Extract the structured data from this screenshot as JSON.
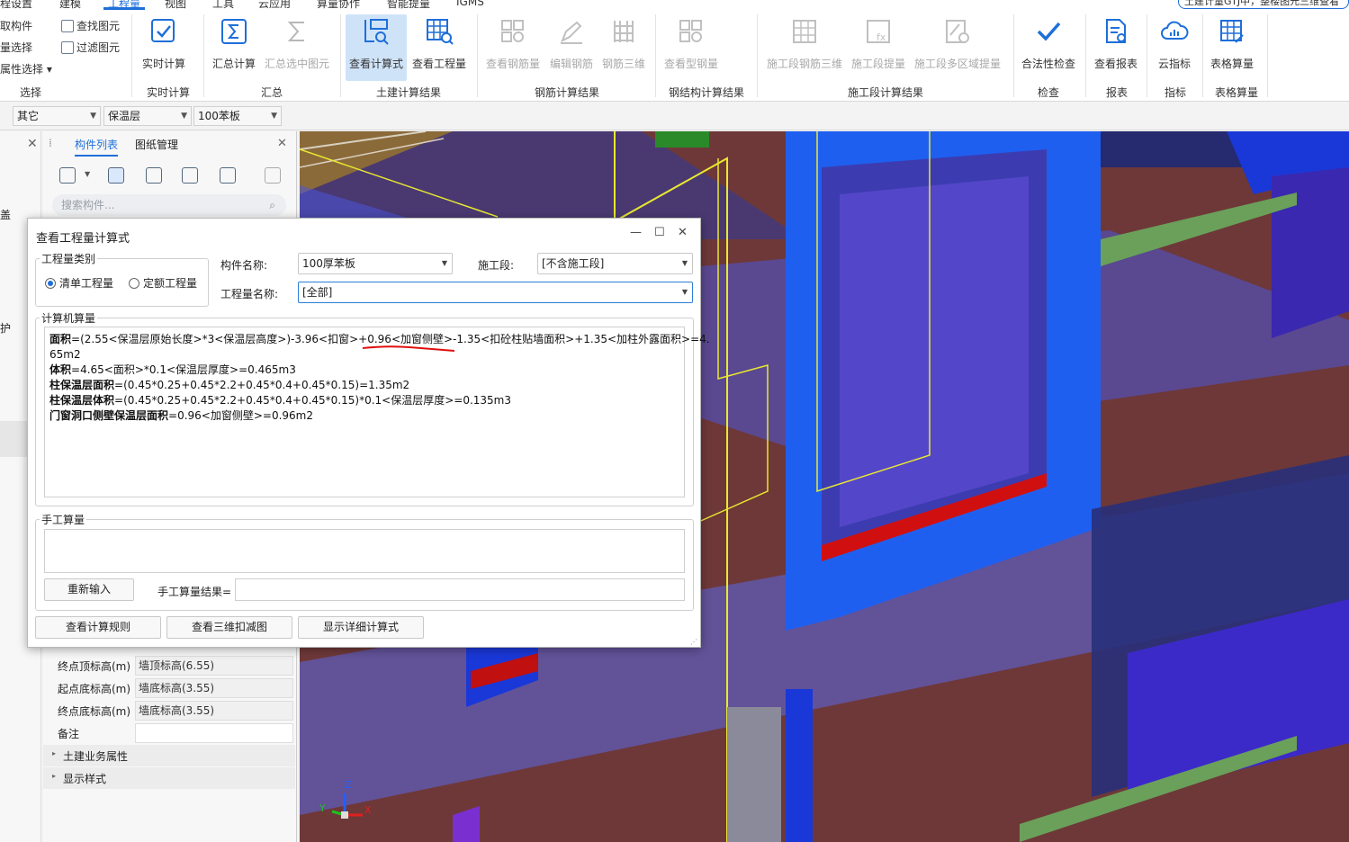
{
  "menu": {
    "items": [
      "程设置",
      "建模",
      "工程量",
      "视图",
      "工具",
      "云应用",
      "算量协作",
      "智能提量",
      "IGMS"
    ],
    "active_index": 2
  },
  "notice": "土建计量GTJ中，整楼图元三维查看",
  "ribbon": {
    "select_group": {
      "label": "选择",
      "cmds": [
        "取构件",
        "量选择",
        "属性选择"
      ],
      "cmds2": [
        "查找图元",
        "过滤图元"
      ]
    },
    "realtime_group": {
      "label": "实时计算",
      "btn": "实时计算"
    },
    "summary_group": {
      "label": "汇总",
      "btns": [
        "汇总计算",
        "汇总选中图元"
      ]
    },
    "civil_group": {
      "label": "土建计算结果",
      "btns": [
        "查看计算式",
        "查看工程量"
      ]
    },
    "rebar_group": {
      "label": "钢筋计算结果",
      "btns": [
        "查看钢筋量",
        "编辑钢筋",
        "钢筋三维"
      ]
    },
    "steel_group": {
      "label": "钢结构计算结果",
      "btns": [
        "查看型钢量"
      ]
    },
    "stage_group": {
      "label": "施工段计算结果",
      "btns": [
        "施工段钢筋三维",
        "施工段提量",
        "施工段多区域提量"
      ]
    },
    "check_group": {
      "label": "检查",
      "btn": "合法性检查"
    },
    "report_group": {
      "label": "报表",
      "btn": "查看报表"
    },
    "index_group": {
      "label": "指标",
      "btn": "云指标"
    },
    "table_group": {
      "label": "表格算量",
      "btn": "表格算量"
    }
  },
  "propbar": {
    "combo1": "其它",
    "combo2": "保温层",
    "combo3": "100苯板"
  },
  "leftstrip": {
    "labels": [
      "盖",
      "护"
    ]
  },
  "leftpanel": {
    "tabs": [
      "构件列表",
      "图纸管理"
    ],
    "search_placeholder": "搜索构件...",
    "props": [
      {
        "key": "终点顶标高(m)",
        "value": "墙顶标高(6.55)"
      },
      {
        "key": "起点底标高(m)",
        "value": "墙底标高(3.55)"
      },
      {
        "key": "终点底标高(m)",
        "value": "墙底标高(3.55)"
      },
      {
        "key": "备注",
        "value": ""
      }
    ],
    "sections": [
      "土建业务属性",
      "显示样式"
    ]
  },
  "dialog": {
    "title": "查看工程量计算式",
    "qty_type_label": "工程量类别",
    "radio_list": "清单工程量",
    "radio_quota": "定额工程量",
    "component_name_label": "构件名称:",
    "component_name_value": "100厚苯板",
    "stage_label": "施工段:",
    "stage_value": "[不含施工段]",
    "qty_name_label": "工程量名称:",
    "qty_name_value": "[全部]",
    "computer_label": "计算机算量",
    "lines": [
      {
        "bold": "面积",
        "rest": "=(2.55<保温层原始长度>*3<保温层高度>)-3.96<扣窗>+0.96<加窗侧壁>-1.35<扣砼柱贴墙面积>+1.35<加柱外露面积>=4."
      },
      {
        "bold": "",
        "rest": "65m2"
      },
      {
        "bold": "体积",
        "rest": "=4.65<面积>*0.1<保温层厚度>=0.465m3"
      },
      {
        "bold": "柱保温层面积",
        "rest": "=(0.45*0.25+0.45*2.2+0.45*0.4+0.45*0.15)=1.35m2"
      },
      {
        "bold": "柱保温层体积",
        "rest": "=(0.45*0.25+0.45*2.2+0.45*0.4+0.45*0.15)*0.1<保温层厚度>=0.135m3"
      },
      {
        "bold": "门窗洞口侧壁保温层面积",
        "rest": "=0.96<加窗侧壁>=0.96m2"
      }
    ],
    "manual_label": "手工算量",
    "reenter_btn": "重新输入",
    "manual_result_label": "手工算量结果=",
    "btn_rules": "查看计算规则",
    "btn_3d": "查看三维扣减图",
    "btn_detail": "显示详细计算式"
  },
  "axes": {
    "x": "X",
    "y": "Y",
    "z": "Z"
  },
  "colors": {
    "accent": "#1e6fd9",
    "wall": "#6e3838",
    "window_frame": "#1a55e8",
    "annotation": "#e01010"
  }
}
